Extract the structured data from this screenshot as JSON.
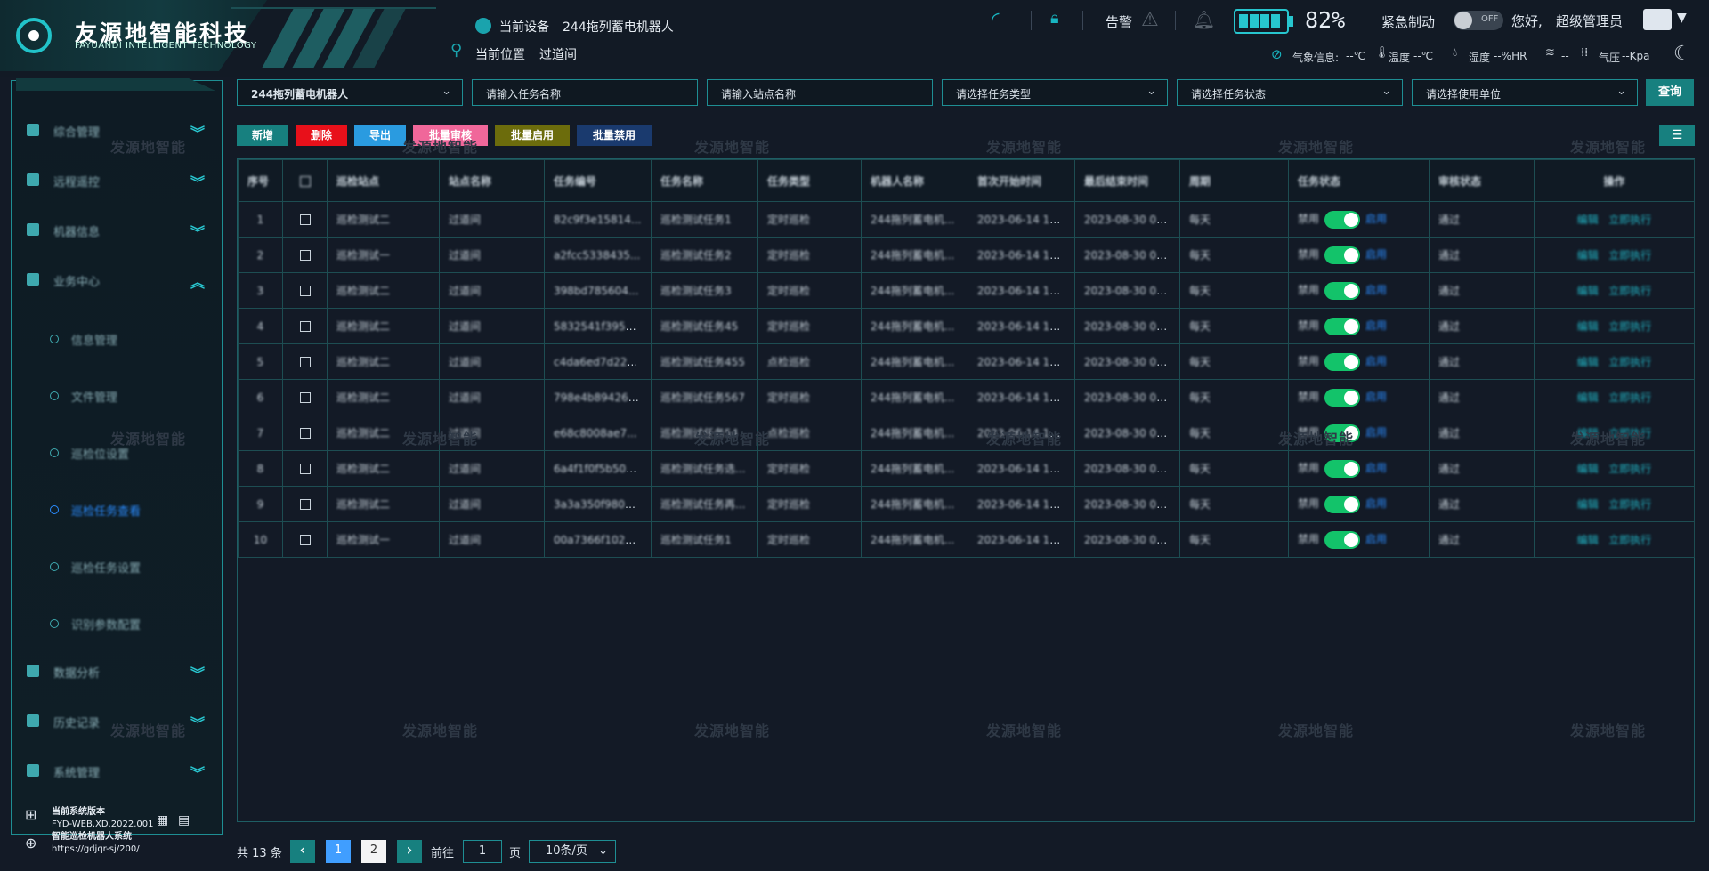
{
  "header": {
    "logo_title": "友源地智能科技",
    "logo_subtitle": "FAYUANDI INTELLIGENT TECHNOLOGY",
    "device_label": "当前设备",
    "device_value": "244拖列蓄电机器人",
    "location_label": "当前位置",
    "location_value": "过道间",
    "alarm_label": "告警",
    "battery_percent": "82%",
    "emergency_label": "紧急制动",
    "toggle_state": "OFF",
    "greeting": "您好,",
    "user_name": "超级管理员",
    "weather": {
      "label": "气象信息:",
      "temp_label": "温度",
      "temp_value": "--℃",
      "temp2_label": "温度",
      "temp2_value": "--℃",
      "humidity_label": "湿度",
      "humidity_value": "--%HR",
      "wind_value": "--",
      "pressure_label": "气压",
      "pressure_value": "--Kpa"
    }
  },
  "sidebar": {
    "items": [
      {
        "label": "综合管理",
        "chevron": "︾"
      },
      {
        "label": "远程遥控",
        "chevron": "︾"
      },
      {
        "label": "机器信息",
        "chevron": "︾"
      },
      {
        "label": "业务中心",
        "chevron": "︽"
      }
    ],
    "subitems": [
      "信息管理",
      "文件管理",
      "巡检位设置",
      "巡检任务查看",
      "巡检任务设置",
      "识别参数配置"
    ],
    "active_sub": 3,
    "items_bottom": [
      {
        "label": "数据分析",
        "chevron": "︾"
      },
      {
        "label": "历史记录",
        "chevron": "︾"
      },
      {
        "label": "系统管理",
        "chevron": "︾"
      }
    ],
    "version_label": "当前系统版本",
    "version_value": "FYD-WEB.XD.2022.001",
    "system_name": "智能巡检机器人系统",
    "system_url": "https://gdjqr-sj/200/"
  },
  "filters": {
    "robot": "244拖列蓄电机器人",
    "task_name_placeholder": "请输入任务名称",
    "site_name_placeholder": "请输入站点名称",
    "task_type_placeholder": "请选择任务类型",
    "task_status_placeholder": "请选择任务状态",
    "unit_placeholder": "请选择使用单位",
    "query_label": "查询"
  },
  "actions": {
    "add": "新增",
    "delete": "删除",
    "export": "导出",
    "batch_review": "批量审核",
    "batch_enable": "批量启用",
    "batch_disable": "批量禁用",
    "menu_icon": "list-icon"
  },
  "table": {
    "columns": [
      "序号",
      "",
      "巡检站点",
      "站点名称",
      "任务编号",
      "任务名称",
      "任务类型",
      "机器人名称",
      "首次开始时间",
      "最后结束时间",
      "周期",
      "任务状态",
      "审核状态",
      "操作"
    ],
    "rows": [
      {
        "no": "1",
        "point": "巡检测试二",
        "site": "过道间",
        "code": "82c9f3e15814...",
        "name": "巡检测试任务1",
        "type": "定时巡检",
        "robot": "244拖列蓄电机...",
        "start": "2023-06-14 18:...",
        "end": "2023-08-30 00:...",
        "cycle": "每天",
        "disable": "禁用",
        "enable": "启用",
        "review": "通过",
        "edit": "编辑",
        "run": "立即执行"
      },
      {
        "no": "2",
        "point": "巡检测试一",
        "site": "过道间",
        "code": "a2fcc5338435...",
        "name": "巡检测试任务2",
        "type": "定时巡检",
        "robot": "244拖列蓄电机...",
        "start": "2023-06-14 18:...",
        "end": "2023-08-30 00:...",
        "cycle": "每天",
        "disable": "禁用",
        "enable": "启用",
        "review": "通过",
        "edit": "编辑",
        "run": "立即执行"
      },
      {
        "no": "3",
        "point": "巡检测试二",
        "site": "过道间",
        "code": "398bd785604...",
        "name": "巡检测试任务3",
        "type": "定时巡检",
        "robot": "244拖列蓄电机...",
        "start": "2023-06-14 18:...",
        "end": "2023-08-30 00:...",
        "cycle": "每天",
        "disable": "禁用",
        "enable": "启用",
        "review": "通过",
        "edit": "编辑",
        "run": "立即执行"
      },
      {
        "no": "4",
        "point": "巡检测试二",
        "site": "过道间",
        "code": "5832541f39594...",
        "name": "巡检测试任务45",
        "type": "定时巡检",
        "robot": "244拖列蓄电机...",
        "start": "2023-06-14 18:...",
        "end": "2023-08-30 00:...",
        "cycle": "每天",
        "disable": "禁用",
        "enable": "启用",
        "review": "通过",
        "edit": "编辑",
        "run": "立即执行"
      },
      {
        "no": "5",
        "point": "巡检测试二",
        "site": "过道间",
        "code": "c4da6ed7d222...",
        "name": "巡检测试任务455",
        "type": "点检巡检",
        "robot": "244拖列蓄电机...",
        "start": "2023-06-14 18:...",
        "end": "2023-08-30 00:...",
        "cycle": "每天",
        "disable": "禁用",
        "enable": "启用",
        "review": "通过",
        "edit": "编辑",
        "run": "立即执行"
      },
      {
        "no": "6",
        "point": "巡检测试二",
        "site": "过道间",
        "code": "798e4b894268...",
        "name": "巡检测试任务567",
        "type": "定时巡检",
        "robot": "244拖列蓄电机...",
        "start": "2023-06-14 18:...",
        "end": "2023-08-30 00:...",
        "cycle": "每天",
        "disable": "禁用",
        "enable": "启用",
        "review": "通过",
        "edit": "编辑",
        "run": "立即执行"
      },
      {
        "no": "7",
        "point": "巡检测试二",
        "site": "过道间",
        "code": "e68c8008ae7...",
        "name": "巡检测试任务54",
        "type": "点检巡检",
        "robot": "244拖列蓄电机...",
        "start": "2023-06-14 18:...",
        "end": "2023-08-30 00:...",
        "cycle": "每天",
        "disable": "禁用",
        "enable": "启用",
        "review": "通过",
        "edit": "编辑",
        "run": "立即执行"
      },
      {
        "no": "8",
        "point": "巡检测试二",
        "site": "过道间",
        "code": "6a4f1f0f5b5044...",
        "name": "巡检测试任务选...",
        "type": "定时巡检",
        "robot": "244拖列蓄电机...",
        "start": "2023-06-14 18:...",
        "end": "2023-08-30 00:...",
        "cycle": "每天",
        "disable": "禁用",
        "enable": "启用",
        "review": "通过",
        "edit": "编辑",
        "run": "立即执行"
      },
      {
        "no": "9",
        "point": "巡检测试二",
        "site": "过道间",
        "code": "3a3a350f9804...",
        "name": "巡检测试任务再...",
        "type": "定时巡检",
        "robot": "244拖列蓄电机...",
        "start": "2023-06-14 18:...",
        "end": "2023-08-30 00:...",
        "cycle": "每天",
        "disable": "禁用",
        "enable": "启用",
        "review": "通过",
        "edit": "编辑",
        "run": "立即执行"
      },
      {
        "no": "10",
        "point": "巡检测试一",
        "site": "过道间",
        "code": "00a7366f1029...",
        "name": "巡检测试任务1",
        "type": "定时巡检",
        "robot": "244拖列蓄电机...",
        "start": "2023-06-14 18:...",
        "end": "2023-08-30 00:...",
        "cycle": "每天",
        "disable": "禁用",
        "enable": "启用",
        "review": "通过",
        "edit": "编辑",
        "run": "立即执行"
      }
    ]
  },
  "pagination": {
    "total_prefix": "共",
    "total": "13",
    "total_suffix": "条",
    "prev_icon": "‹",
    "pages": [
      "1",
      "2"
    ],
    "current": "1",
    "next_icon": "›",
    "goto_label": "前往",
    "goto_value": "1",
    "page_suffix": "页",
    "page_size": "10条/页"
  },
  "watermark": "发源地智能",
  "colors": {
    "accent": "#1e8e93",
    "primary_btn": "#17807f",
    "switch_on": "#13c36a",
    "delete": "#e8101a",
    "export": "#2a9be0",
    "review": "#f0679a",
    "enable_batch": "#6c6c0c",
    "disable_batch": "#1a3a6e"
  }
}
